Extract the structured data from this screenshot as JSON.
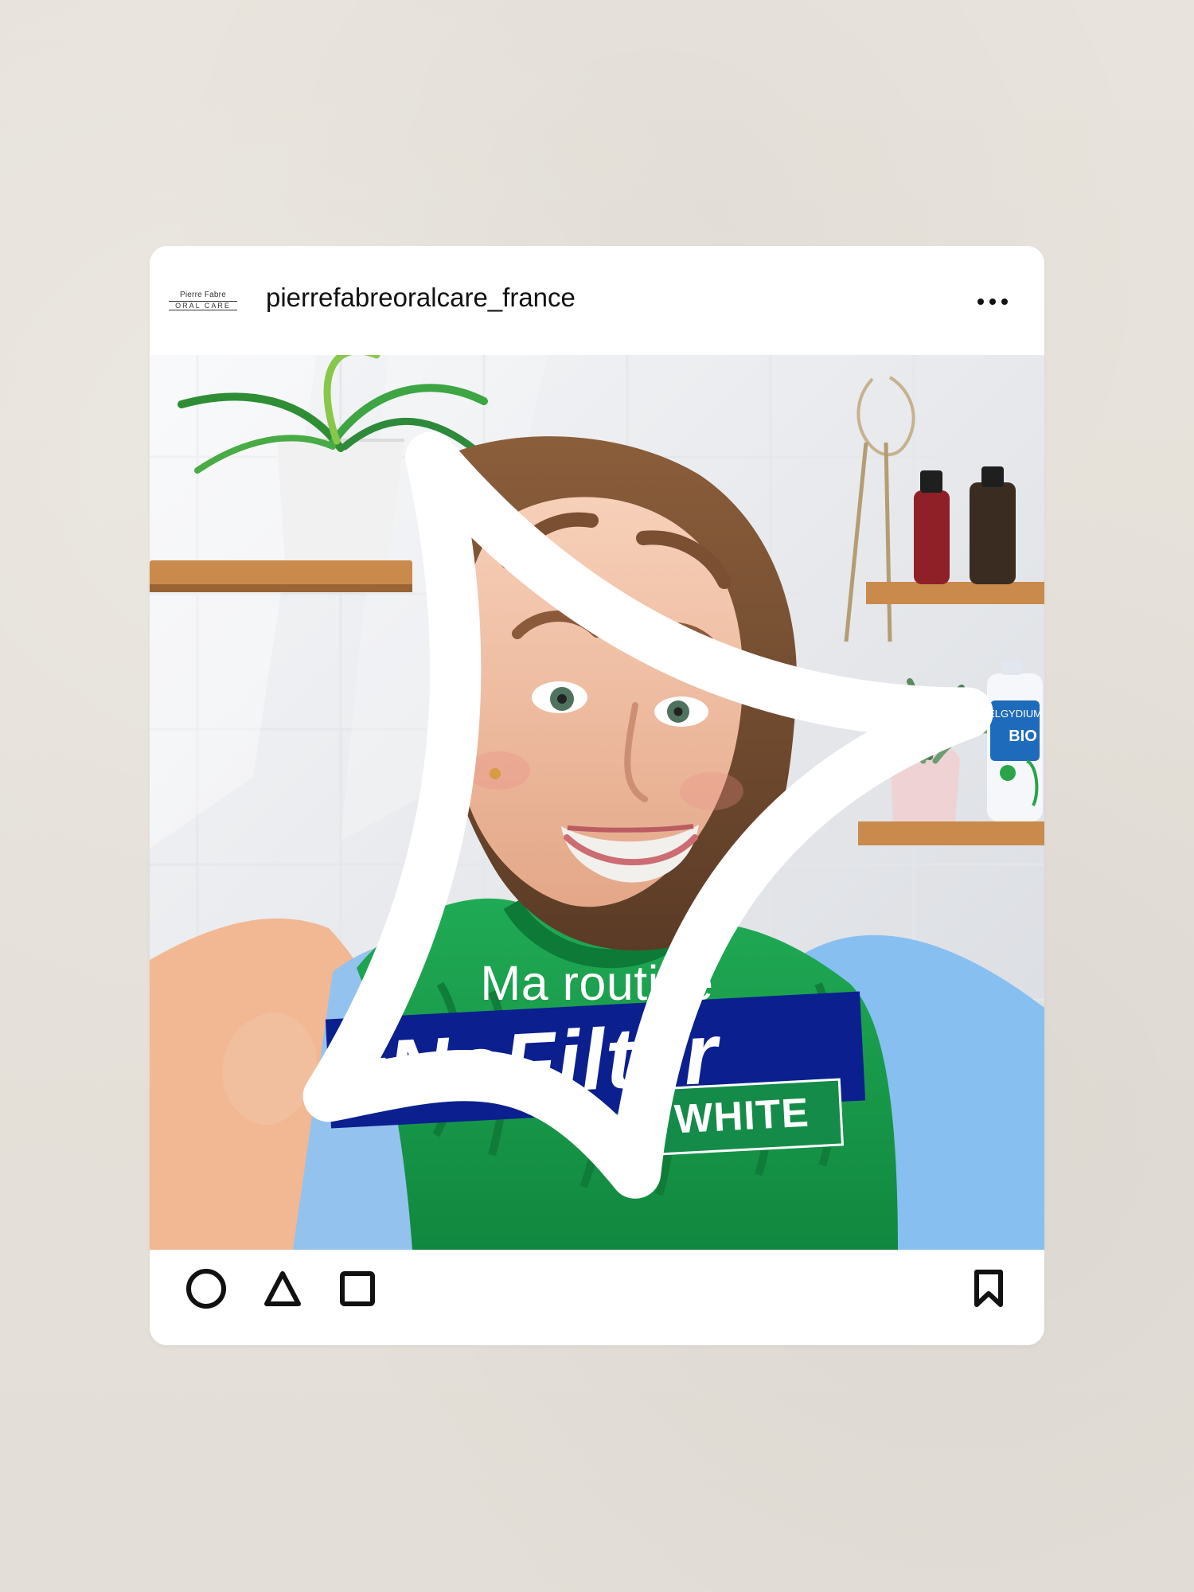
{
  "post": {
    "account_name": "pierrefabreoralcare_france",
    "brand_logo": {
      "top_text": "Pierre Fabre",
      "bottom_text": "ORAL CARE"
    },
    "caption_top": "Ma routine",
    "headline": "#NoFilter",
    "subtag": "WHITE",
    "product_labels": {
      "brand": "ELGYDIUM",
      "organic": "BIO"
    }
  },
  "icons": {
    "more": "more-dots-icon",
    "like": "circle-icon",
    "comment": "triangle-icon",
    "share": "square-icon",
    "save": "bookmark-icon",
    "sparkle": "sparkle-icon"
  },
  "colors": {
    "background": "#e6e1da",
    "card": "#ffffff",
    "headline_band": "#0b1f8f",
    "headline_text": "#ffffff",
    "subtag_fill": "#148b48",
    "text_primary": "#111111"
  }
}
